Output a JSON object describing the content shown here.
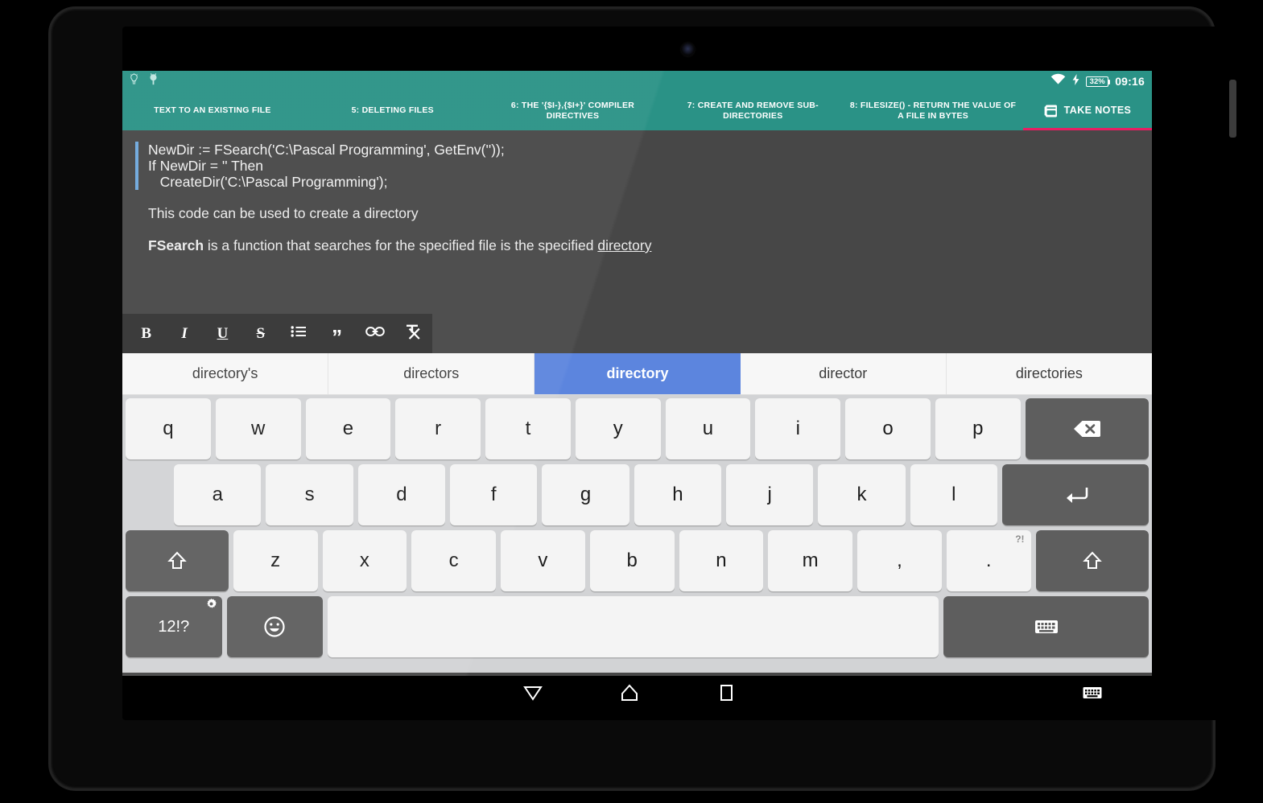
{
  "status_bar": {
    "notification_icons": [
      "lightbulb-icon",
      "plug-icon"
    ],
    "wifi_icon": "wifi-icon",
    "charging_icon": "charging-bolt-icon",
    "battery_percent": "32%",
    "time": "09:16"
  },
  "tabs": [
    {
      "label": "TEXT TO AN EXISTING FILE",
      "name": "tab-text-to-existing-file"
    },
    {
      "label": "5: DELETING FILES",
      "name": "tab-deleting-files"
    },
    {
      "label": "6: THE '{$I-},{$I+}' COMPILER DIRECTIVES",
      "name": "tab-compiler-directives"
    },
    {
      "label": "7: CREATE AND REMOVE SUB-DIRECTORIES",
      "name": "tab-create-remove-subdirectories"
    },
    {
      "label": "8: FILESIZE() - RETURN THE VALUE OF A FILE IN BYTES",
      "name": "tab-filesize"
    }
  ],
  "take_notes_tab": {
    "label": "TAKE NOTES",
    "icon": "notes-icon",
    "underline_color": "#e91e63"
  },
  "note": {
    "code_lines": [
      "NewDir := FSearch('C:\\Pascal Programming', GetEnv(''));",
      "If NewDir = '' Then",
      "   CreateDir('C:\\Pascal Programming');"
    ],
    "paragraph_1": "This code can be used to create a directory",
    "paragraph_2_bold": "FSearch",
    "paragraph_2_mid": " is a function that searches for the specified file is the specified ",
    "paragraph_2_link": "directory"
  },
  "format_toolbar": [
    {
      "name": "bold-button",
      "glyph": "B",
      "label": "Bold"
    },
    {
      "name": "italic-button",
      "glyph": "I",
      "label": "Italic"
    },
    {
      "name": "underline-button",
      "glyph": "U",
      "label": "Underline"
    },
    {
      "name": "strikethrough-button",
      "glyph": "S",
      "label": "Strikethrough"
    },
    {
      "name": "bullet-list-button",
      "glyph": "list",
      "label": "Bullet list"
    },
    {
      "name": "quote-button",
      "glyph": "”",
      "label": "Quote"
    },
    {
      "name": "link-button",
      "glyph": "link",
      "label": "Link"
    },
    {
      "name": "clear-format-button",
      "glyph": "Tx",
      "label": "Clear formatting"
    }
  ],
  "suggestions": [
    {
      "word": "directory's",
      "active": false
    },
    {
      "word": "directors",
      "active": false
    },
    {
      "word": "directory",
      "active": true
    },
    {
      "word": "director",
      "active": false
    },
    {
      "word": "directories",
      "active": false
    }
  ],
  "keyboard": {
    "row1": [
      "q",
      "w",
      "e",
      "r",
      "t",
      "y",
      "u",
      "i",
      "o",
      "p"
    ],
    "backspace_label": "backspace-icon",
    "row2": [
      "a",
      "s",
      "d",
      "f",
      "g",
      "h",
      "j",
      "k",
      "l"
    ],
    "enter_label": "enter-icon",
    "row3": [
      "z",
      "x",
      "c",
      "v",
      "b",
      "n",
      "m",
      ",",
      "."
    ],
    "period_superscript": "?!",
    "shift_label": "shift-icon",
    "symbols_key": "12!?",
    "symbols_gear": "gear-icon",
    "emoji_key": "emoji-icon",
    "space_key": "space-bar",
    "switch_keyboard_key": "keyboard-switch-icon"
  },
  "nav_bar": {
    "back": "back-triangle-icon",
    "home": "home-icon",
    "recents": "recents-square-icon",
    "keyboard_toggle": "keyboard-icon"
  },
  "colors": {
    "teal": "#2a9286",
    "pink_accent": "#e91e63",
    "editor_bg": "#474747",
    "toolbar_bg": "#333333",
    "suggestion_active": "#5c85de",
    "keyboard_bg": "#d2d3d5",
    "key_light": "#f4f4f4",
    "key_dark": "#5e5e5e"
  }
}
